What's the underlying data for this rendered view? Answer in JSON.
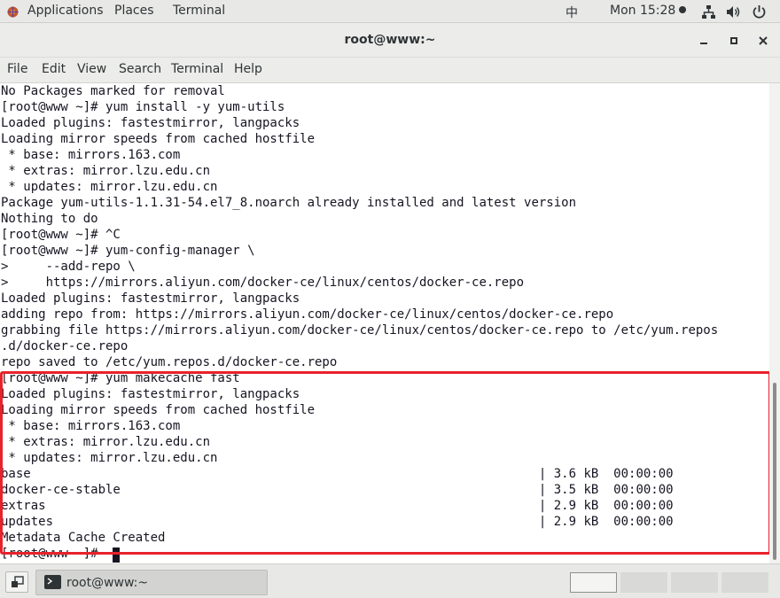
{
  "topbar": {
    "applications": "Applications",
    "places": "Places",
    "terminal": "Terminal",
    "input_method": "中",
    "clock": "Mon 15:28",
    "icons": [
      "network-icon",
      "volume-icon",
      "power-icon"
    ]
  },
  "window": {
    "title": "root@www:~"
  },
  "menubar": {
    "items": [
      "File",
      "Edit",
      "View",
      "Search",
      "Terminal",
      "Help"
    ]
  },
  "terminal": {
    "lines": [
      "No Packages marked for removal",
      "[root@www ~]# yum install -y yum-utils",
      "Loaded plugins: fastestmirror, langpacks",
      "Loading mirror speeds from cached hostfile",
      " * base: mirrors.163.com",
      " * extras: mirror.lzu.edu.cn",
      " * updates: mirror.lzu.edu.cn",
      "Package yum-utils-1.1.31-54.el7_8.noarch already installed and latest version",
      "Nothing to do",
      "[root@www ~]# ^C",
      "[root@www ~]# yum-config-manager \\",
      ">     --add-repo \\",
      ">     https://mirrors.aliyun.com/docker-ce/linux/centos/docker-ce.repo",
      "Loaded plugins: fastestmirror, langpacks",
      "adding repo from: https://mirrors.aliyun.com/docker-ce/linux/centos/docker-ce.repo",
      "grabbing file https://mirrors.aliyun.com/docker-ce/linux/centos/docker-ce.repo to /etc/yum.repos",
      ".d/docker-ce.repo",
      "repo saved to /etc/yum.repos.d/docker-ce.repo",
      "[root@www ~]# yum makecache fast",
      "Loaded plugins: fastestmirror, langpacks",
      "Loading mirror speeds from cached hostfile",
      " * base: mirrors.163.com",
      " * extras: mirror.lzu.edu.cn",
      " * updates: mirror.lzu.edu.cn",
      "base                                                                    | 3.6 kB  00:00:00",
      "docker-ce-stable                                                        | 3.5 kB  00:00:00",
      "extras                                                                  | 2.9 kB  00:00:00",
      "updates                                                                 | 2.9 kB  00:00:00",
      "Metadata Cache Created",
      "[root@www ~]# "
    ],
    "highlight_color": "#e8222b"
  },
  "taskbar": {
    "task_label": "root@www:~",
    "workspace_count": 4,
    "active_workspace": 1
  }
}
